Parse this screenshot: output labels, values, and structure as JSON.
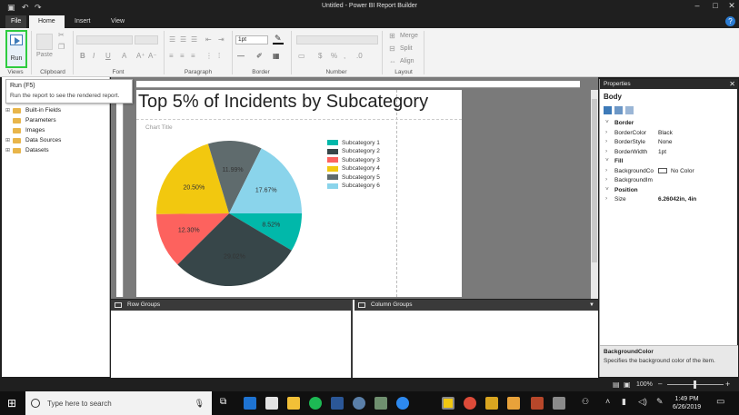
{
  "app": {
    "title": "Untitled - Power BI Report Builder"
  },
  "tabs": [
    {
      "label": "File"
    },
    {
      "label": "Home"
    },
    {
      "label": "Insert"
    },
    {
      "label": "View"
    }
  ],
  "ribbon": {
    "run_label": "Run",
    "paste_label": "Paste",
    "font_size_value": "1pt",
    "merge_label": "Merge",
    "split_label": "Split",
    "align_label": "Align",
    "groups": [
      "Views",
      "Clipboard",
      "Font",
      "Paragraph",
      "Border",
      "Number",
      "Layout"
    ]
  },
  "tooltip": {
    "title": "Run (F5)",
    "text": "Run the report to see the rendered report."
  },
  "report_data": {
    "items": [
      "Built-in Fields",
      "Parameters",
      "Images",
      "Data Sources",
      "Datasets"
    ]
  },
  "report": {
    "title": "Top 5% of Incidents by Subcategory",
    "chart_title": "Chart Title"
  },
  "chart_data": {
    "type": "pie",
    "categories": [
      "Subcategory 1",
      "Subcategory 2",
      "Subcategory 3",
      "Subcategory 4",
      "Subcategory 5",
      "Subcategory 6"
    ],
    "values": [
      8.52,
      29.02,
      12.3,
      20.5,
      11.99,
      17.67
    ],
    "labels": [
      "8.52%",
      "29.02%",
      "12.30%",
      "20.50%",
      "11.99%",
      "17.67%"
    ],
    "colors": [
      "#01b8aa",
      "#374649",
      "#fd625e",
      "#f2c80f",
      "#5f6b6d",
      "#8ad4eb"
    ],
    "title": "Chart Title",
    "legend_position": "right"
  },
  "groups": {
    "row": "Row Groups",
    "column": "Column Groups"
  },
  "properties": {
    "header": "Properties",
    "object": "Body",
    "rows": [
      {
        "type": "cat",
        "key": "Border"
      },
      {
        "type": "prop",
        "key": "BorderColor",
        "value": "Black"
      },
      {
        "type": "prop",
        "key": "BorderStyle",
        "value": "None"
      },
      {
        "type": "prop",
        "key": "BorderWidth",
        "value": "1pt"
      },
      {
        "type": "cat",
        "key": "Fill"
      },
      {
        "type": "prop",
        "key": "BackgroundCo",
        "value": "No Color",
        "swatch": true
      },
      {
        "type": "prop",
        "key": "BackgroundIm",
        "value": ""
      },
      {
        "type": "cat",
        "key": "Position"
      },
      {
        "type": "prop",
        "key": "Size",
        "value": "6.26042in, 4in",
        "bold": true
      }
    ],
    "desc_title": "BackgroundColor",
    "desc_text": "Specifies the background color of the item."
  },
  "status": {
    "zoom": "100%"
  },
  "taskbar": {
    "search_placeholder": "Type here to search",
    "time": "1:49 PM",
    "date": "6/26/2019"
  }
}
